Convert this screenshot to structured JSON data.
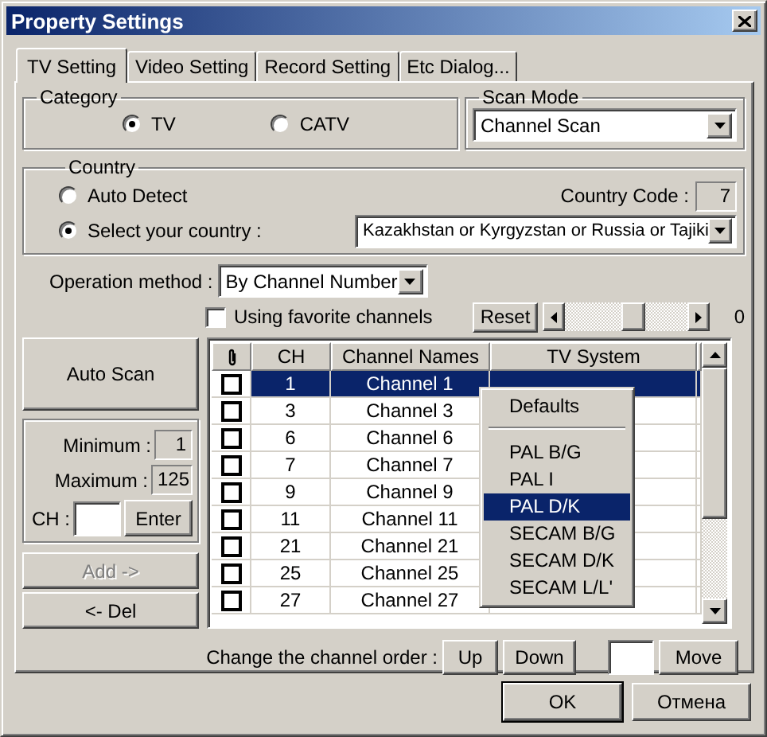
{
  "window": {
    "title": "Property Settings"
  },
  "tabs": [
    {
      "label": "TV Setting",
      "selected": true
    },
    {
      "label": "Video Setting",
      "selected": false
    },
    {
      "label": "Record Setting",
      "selected": false
    },
    {
      "label": "Etc Dialog...",
      "selected": false
    }
  ],
  "category": {
    "label": "Category",
    "options": [
      {
        "label": "TV",
        "selected": true
      },
      {
        "label": "CATV",
        "selected": false
      }
    ]
  },
  "scan_mode": {
    "label": "Scan Mode",
    "value": "Channel Scan"
  },
  "country": {
    "label": "Country",
    "options": [
      {
        "label": "Auto Detect",
        "selected": false
      },
      {
        "label": "Select your country :",
        "selected": true
      }
    ],
    "code_label": "Country Code :",
    "code": "7",
    "value": "Kazakhstan or Kyrgyzstan or Russia or Tajiki"
  },
  "operation_method": {
    "label": "Operation method :",
    "value": "By Channel Number"
  },
  "favorites": {
    "label": "Using favorite channels",
    "checked": false
  },
  "reset_button": "Reset",
  "slider": {
    "level": 0.57
  },
  "slider_value": "0",
  "auto_scan_button": "Auto Scan",
  "range": {
    "minimum_label": "Minimum :",
    "minimum": "1",
    "maximum_label": "Maximum :",
    "maximum": "125",
    "ch_label": "CH :",
    "enter_button": "Enter"
  },
  "side_buttons": [
    {
      "label": "Add ->",
      "disabled": true
    },
    {
      "label": "<- Del",
      "disabled": false
    }
  ],
  "table": {
    "columns": [
      "CH",
      "Channel Names",
      "TV System"
    ],
    "rows": [
      {
        "checked": false,
        "ch": "1",
        "name": "Channel 1",
        "selected": true
      },
      {
        "checked": false,
        "ch": "3",
        "name": "Channel 3",
        "selected": false
      },
      {
        "checked": false,
        "ch": "6",
        "name": "Channel 6",
        "selected": false
      },
      {
        "checked": false,
        "ch": "7",
        "name": "Channel 7",
        "selected": false
      },
      {
        "checked": false,
        "ch": "9",
        "name": "Channel 9",
        "selected": false
      },
      {
        "checked": false,
        "ch": "11",
        "name": "Channel 11",
        "selected": false
      },
      {
        "checked": false,
        "ch": "21",
        "name": "Channel 21",
        "selected": false
      },
      {
        "checked": false,
        "ch": "25",
        "name": "Channel 25",
        "selected": false
      },
      {
        "checked": false,
        "ch": "27",
        "name": "Channel 27",
        "selected": false
      }
    ]
  },
  "popup_menu": {
    "items": [
      {
        "kind": "item",
        "label": "Defaults",
        "selected": false
      },
      {
        "kind": "separator"
      },
      {
        "kind": "item",
        "label": "PAL B/G",
        "selected": false
      },
      {
        "kind": "item",
        "label": "PAL I",
        "selected": false
      },
      {
        "kind": "item",
        "label": "PAL D/K",
        "selected": true
      },
      {
        "kind": "item",
        "label": "SECAM B/G",
        "selected": false
      },
      {
        "kind": "item",
        "label": "SECAM D/K",
        "selected": false
      },
      {
        "kind": "item",
        "label": "SECAM L/L'",
        "selected": false
      }
    ]
  },
  "order": {
    "label": "Change the channel order :",
    "up": "Up",
    "down": "Down",
    "move": "Move"
  },
  "buttons": [
    {
      "label": "OK",
      "default": true
    },
    {
      "label": "Отмена",
      "default": false
    }
  ]
}
